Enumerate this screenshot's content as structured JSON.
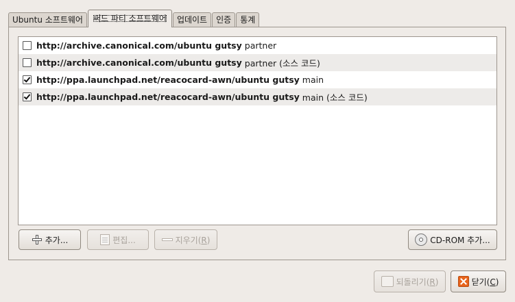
{
  "tabs": [
    {
      "label": "Ubuntu 소프트웨어"
    },
    {
      "label": "써드 파티 소프트웨어"
    },
    {
      "label": "업데이트"
    },
    {
      "label": "인증"
    },
    {
      "label": "통계"
    }
  ],
  "sources": [
    {
      "checked": false,
      "url": "http://archive.canonical.com/ubuntu gutsy",
      "suffix": "partner"
    },
    {
      "checked": false,
      "url": "http://archive.canonical.com/ubuntu gutsy",
      "suffix": "partner (소스 코드)"
    },
    {
      "checked": true,
      "url": "http://ppa.launchpad.net/reacocard-awn/ubuntu gutsy",
      "suffix": "main"
    },
    {
      "checked": true,
      "url": "http://ppa.launchpad.net/reacocard-awn/ubuntu gutsy",
      "suffix": "main (소스 코드)"
    }
  ],
  "buttons": {
    "add": "추가...",
    "edit": "편집...",
    "remove_prefix": "지우기(",
    "remove_key": "R",
    "remove_suffix": ")",
    "add_cdrom": "CD-ROM 추가...",
    "revert_prefix": "되돌리기(",
    "revert_key": "R",
    "revert_suffix": ")",
    "close_prefix": "닫기(",
    "close_key": "C",
    "close_suffix": ")"
  },
  "icons": {
    "add": "plus-icon",
    "edit": "edit-icon",
    "remove": "minus-icon",
    "cdrom": "cd-icon",
    "revert": "undo-icon",
    "close": "close-icon"
  },
  "colors": {
    "window_bg": "#efebe7",
    "close_icon": "#e8641b"
  }
}
